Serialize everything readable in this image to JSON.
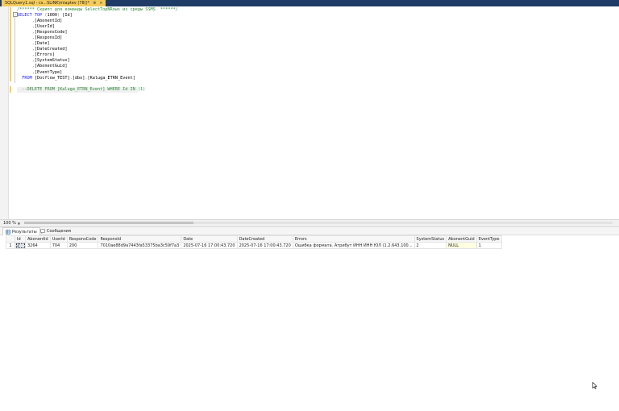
{
  "window": {
    "tab_title": "SQLQuery1.sql - cs...SLINK\\mlaptev (78))*",
    "pin_glyph": "⊕",
    "close_glyph": "×"
  },
  "editor": {
    "lines": [
      {
        "segs": [
          [
            "cm",
            "/****** Скрипт для команды SelectTopNRows из среды SSMS  ******/"
          ]
        ]
      },
      {
        "segs": [
          [
            "kw",
            "SELECT TOP"
          ],
          [
            "txt",
            " "
          ],
          [
            "gy",
            "("
          ],
          [
            "txt",
            "1000"
          ],
          [
            "gy",
            ")"
          ],
          [
            "txt",
            " [Id]"
          ]
        ]
      },
      {
        "segs": [
          [
            "txt",
            "      "
          ],
          [
            "gy",
            ","
          ],
          [
            "txt",
            "[AbonentId]"
          ]
        ]
      },
      {
        "segs": [
          [
            "txt",
            "      "
          ],
          [
            "gy",
            ","
          ],
          [
            "txt",
            "[UserId]"
          ]
        ]
      },
      {
        "segs": [
          [
            "txt",
            "      "
          ],
          [
            "gy",
            ","
          ],
          [
            "txt",
            "[ResponsCode]"
          ]
        ]
      },
      {
        "segs": [
          [
            "txt",
            "      "
          ],
          [
            "gy",
            ","
          ],
          [
            "txt",
            "[ResponsId]"
          ]
        ]
      },
      {
        "segs": [
          [
            "txt",
            "      "
          ],
          [
            "gy",
            ","
          ],
          [
            "txt",
            "[Date]"
          ]
        ]
      },
      {
        "segs": [
          [
            "txt",
            "      "
          ],
          [
            "gy",
            ","
          ],
          [
            "txt",
            "[DateCreated]"
          ]
        ]
      },
      {
        "segs": [
          [
            "txt",
            "      "
          ],
          [
            "gy",
            ","
          ],
          [
            "txt",
            "[Errors]"
          ]
        ]
      },
      {
        "segs": [
          [
            "txt",
            "      "
          ],
          [
            "gy",
            ","
          ],
          [
            "txt",
            "[SystemStatus]"
          ]
        ]
      },
      {
        "segs": [
          [
            "txt",
            "      "
          ],
          [
            "gy",
            ","
          ],
          [
            "txt",
            "[AbonentGuid]"
          ]
        ]
      },
      {
        "segs": [
          [
            "txt",
            "      "
          ],
          [
            "gy",
            ","
          ],
          [
            "txt",
            "[EventType]"
          ]
        ]
      },
      {
        "segs": [
          [
            "txt",
            "  "
          ],
          [
            "kw",
            "FROM"
          ],
          [
            "txt",
            " [Docflow_TEST]"
          ],
          [
            "gy",
            "."
          ],
          [
            "txt",
            "[dbo]"
          ],
          [
            "gy",
            "."
          ],
          [
            "txt",
            "[Kaluga_ETRN_Event]"
          ]
        ]
      },
      {
        "segs": [
          [
            "txt",
            ""
          ]
        ]
      },
      {
        "segs": [
          [
            "txt",
            "  "
          ],
          [
            "cm",
            "--DELETE FROM [Kaluga_ETRN_Event] WHERE Id IN (1)"
          ]
        ]
      }
    ]
  },
  "zoom": {
    "label": "100 %"
  },
  "results_tabs": [
    {
      "label": "Результаты",
      "icon": "grid-icon"
    },
    {
      "label": "Сообщения",
      "icon": "message-icon"
    }
  ],
  "grid": {
    "columns": [
      "Id",
      "AbonentId",
      "UserId",
      "ResponsCode",
      "ResponsId",
      "Date",
      "DateCreated",
      "Errors",
      "SystemStatus",
      "AbonentGuid",
      "EventType"
    ],
    "rows": [
      {
        "num": "1",
        "cells": [
          "2",
          "3264",
          "704",
          "200",
          "7010ae88d9a7443fa53375ba3c59f7a3",
          "2025-07-16 17:00:43.720",
          "2025-07-16 17:00:43.720",
          "Ошибка формата. Атрибут ИНН ИНН ЮЛ (1.2.643.100...",
          "2",
          "NULL",
          "1"
        ]
      }
    ]
  }
}
